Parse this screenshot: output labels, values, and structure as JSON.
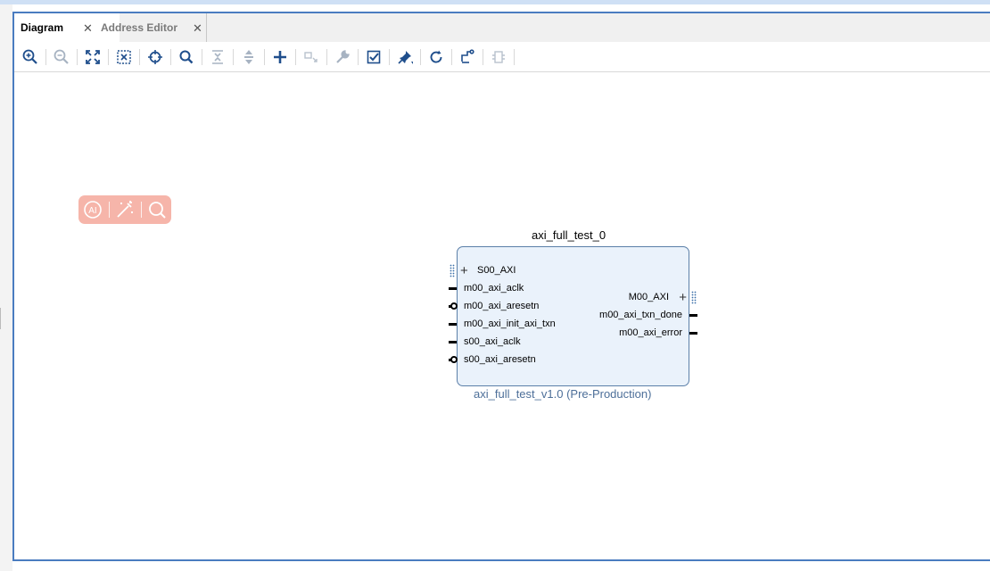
{
  "tabs": [
    {
      "label": "Diagram",
      "active": true
    },
    {
      "label": "Address Editor",
      "active": false
    }
  ],
  "toolbar": {
    "tools": [
      {
        "name": "zoom-in-icon",
        "enabled": true
      },
      {
        "name": "zoom-out-icon",
        "enabled": false
      },
      {
        "name": "zoom-fit-icon",
        "enabled": true
      },
      {
        "name": "zoom-area-icon",
        "enabled": true
      },
      {
        "name": "auto-fit-selection-icon",
        "enabled": true
      },
      {
        "name": "search-icon",
        "enabled": true
      },
      {
        "name": "collapse-all-icon",
        "enabled": false
      },
      {
        "name": "expand-all-icon",
        "enabled": false
      },
      {
        "name": "add-ip-icon",
        "enabled": true
      },
      {
        "name": "make-external-icon",
        "enabled": false
      },
      {
        "name": "properties-wrench-icon",
        "enabled": false
      },
      {
        "name": "validate-design-icon",
        "enabled": true
      },
      {
        "name": "pin-icon",
        "enabled": true
      },
      {
        "name": "regenerate-layout-icon",
        "enabled": true
      },
      {
        "name": "optimize-routing-icon",
        "enabled": true
      },
      {
        "name": "highlight-icon",
        "enabled": false
      }
    ]
  },
  "ai_widget": {
    "icons": [
      "ai-assistant-icon",
      "magic-wand-icon",
      "search-icon"
    ],
    "color": "#f6b5aa"
  },
  "block": {
    "instance_name": "axi_full_test_0",
    "ip_name": "axi_full_test_v1.0 (Pre-Production)",
    "left_ports": [
      {
        "label": "S00_AXI",
        "type": "bus"
      },
      {
        "label": "m00_axi_aclk",
        "type": "input"
      },
      {
        "label": "m00_axi_aresetn",
        "type": "input_inverted"
      },
      {
        "label": "m00_axi_init_axi_txn",
        "type": "input"
      },
      {
        "label": "s00_axi_aclk",
        "type": "input"
      },
      {
        "label": "s00_axi_aresetn",
        "type": "input_inverted"
      }
    ],
    "right_ports": [
      {
        "label": "M00_AXI",
        "type": "bus"
      },
      {
        "label": "m00_axi_txn_done",
        "type": "output"
      },
      {
        "label": "m00_axi_error",
        "type": "output"
      }
    ],
    "colors": {
      "body": "#eaf2fb",
      "border": "#5b7fa8",
      "subtitle": "#4d6f99"
    }
  },
  "colors": {
    "accent": "#4a7cc0",
    "icon": "#1f4e8c"
  }
}
